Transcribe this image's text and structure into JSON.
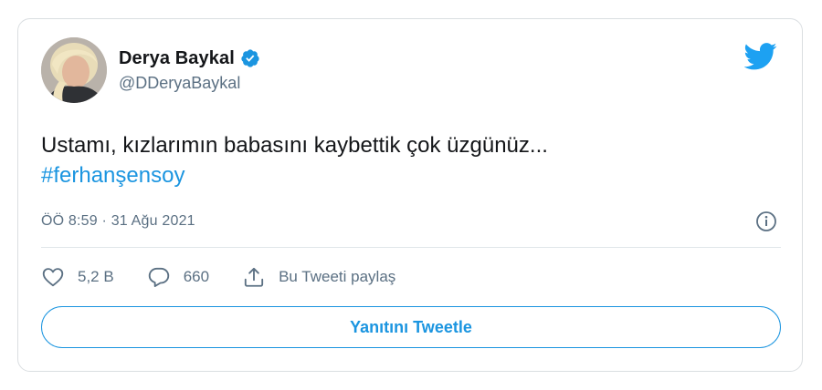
{
  "tweet": {
    "author_name": "Derya Baykal",
    "author_handle": "@DDeryaBaykal",
    "text": "Ustamı, kızlarımın babasını kaybettik çok üzgünüz...",
    "hashtag": "#ferhanşensoy",
    "timestamp": "ÖÖ 8:59 · 31 Ağu 2021"
  },
  "actions": {
    "likes": "5,2 B",
    "replies": "660",
    "share_label": "Bu Tweeti paylaş"
  },
  "reply_button_label": "Yanıtını Tweetle",
  "icons": {
    "verified": "verified-badge-icon",
    "brand": "twitter-bird-icon",
    "info": "info-icon",
    "like": "heart-icon",
    "reply": "speech-bubble-icon",
    "share": "share-icon"
  },
  "colors": {
    "accent": "#1b95e0",
    "text_primary": "#141619",
    "text_secondary": "#5b7083",
    "border": "#dadee1"
  }
}
